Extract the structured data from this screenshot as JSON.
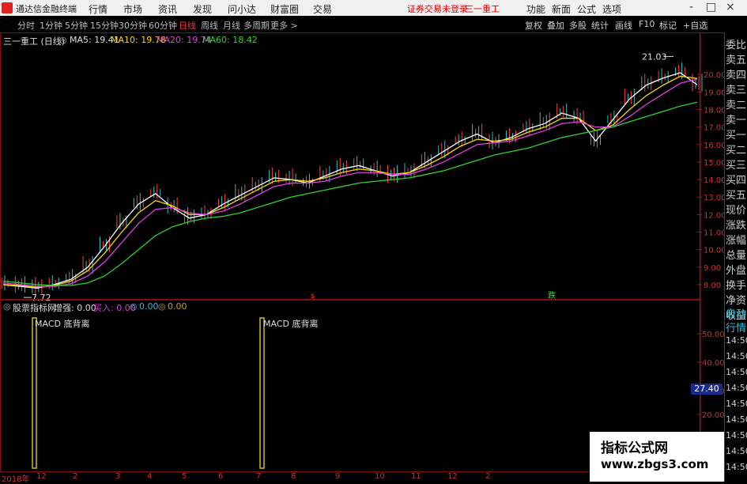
{
  "app": {
    "title": "通达信金融终端"
  },
  "menu": {
    "items": [
      "行情",
      "市场",
      "资讯",
      "发现",
      "问小达",
      "财富圈",
      "交易"
    ]
  },
  "status": {
    "not_logged_in": "证券交易未登录",
    "stock_name": "三一重工"
  },
  "top_buttons": [
    "功能",
    "新面",
    "公式",
    "选项"
  ],
  "window_controls": [
    "-",
    "□",
    "×"
  ],
  "periods": [
    "分时",
    "1分钟",
    "5分钟",
    "15分钟",
    "30分钟",
    "60分钟",
    "日线",
    "周线",
    "月线",
    "多周期",
    "更多 >"
  ],
  "active_period": "日线",
  "right_toolbar": [
    "复权",
    "叠加",
    "多股",
    "统计",
    "画线",
    "F10",
    "标记",
    "+自选"
  ],
  "main_chart": {
    "stock_label": "三一重工 (日线)",
    "ma": [
      {
        "label": "MA5: 19.41",
        "color": "#ffffff"
      },
      {
        "label": "MA10: 19.78",
        "color": "#ffd700"
      },
      {
        "label": "MA20: 19.74",
        "color": "#e040e0"
      },
      {
        "label": "MA60: 18.42",
        "color": "#30d030"
      }
    ],
    "high_label": "21.03",
    "low_label": "7.72",
    "y_ticks": [
      "20.00",
      "19.00",
      "18.00",
      "17.00",
      "16.00",
      "15.00",
      "14.00",
      "13.00",
      "12.00",
      "11.00",
      "10.00",
      "9.00",
      "8.00"
    ],
    "markers": {
      "signal_s": "s",
      "signal_die": "跌"
    }
  },
  "chart_data": {
    "type": "line",
    "title": "三一重工 (日线)",
    "ylim": [
      7.5,
      21.5
    ],
    "series": [
      {
        "name": "MA5",
        "values": [
          8.0,
          7.9,
          7.8,
          8.0,
          8.3,
          9.0,
          10.2,
          11.5,
          12.6,
          13.2,
          12.4,
          11.8,
          12.0,
          12.6,
          13.1,
          13.6,
          14.1,
          14.0,
          13.8,
          14.2,
          14.6,
          14.8,
          14.5,
          14.2,
          14.4,
          15.0,
          15.6,
          16.2,
          16.6,
          16.1,
          16.4,
          16.9,
          17.2,
          17.8,
          17.5,
          16.2,
          17.4,
          18.6,
          19.4,
          19.8,
          20.1,
          19.41
        ]
      },
      {
        "name": "MA10",
        "values": [
          8.0,
          7.95,
          7.85,
          7.95,
          8.2,
          8.8,
          9.8,
          11.0,
          12.1,
          12.8,
          12.5,
          12.0,
          12.0,
          12.4,
          12.9,
          13.4,
          13.9,
          14.0,
          13.9,
          14.1,
          14.4,
          14.6,
          14.5,
          14.3,
          14.4,
          14.8,
          15.3,
          15.9,
          16.3,
          16.2,
          16.3,
          16.7,
          17.0,
          17.5,
          17.5,
          16.8,
          17.1,
          18.0,
          18.8,
          19.4,
          19.9,
          19.78
        ]
      },
      {
        "name": "MA20",
        "values": [
          8.1,
          8.0,
          7.9,
          7.9,
          8.05,
          8.5,
          9.3,
          10.4,
          11.5,
          12.3,
          12.4,
          12.1,
          12.0,
          12.2,
          12.6,
          13.1,
          13.6,
          13.8,
          13.8,
          13.9,
          14.2,
          14.4,
          14.4,
          14.3,
          14.3,
          14.6,
          15.0,
          15.5,
          16.0,
          16.1,
          16.2,
          16.5,
          16.8,
          17.2,
          17.3,
          17.0,
          17.0,
          17.6,
          18.3,
          18.9,
          19.5,
          19.74
        ]
      },
      {
        "name": "MA60",
        "values": [
          8.2,
          8.1,
          8.0,
          7.95,
          7.95,
          8.1,
          8.5,
          9.2,
          10.0,
          10.8,
          11.3,
          11.6,
          11.8,
          11.9,
          12.1,
          12.4,
          12.7,
          13.0,
          13.2,
          13.4,
          13.6,
          13.8,
          13.9,
          14.0,
          14.1,
          14.3,
          14.5,
          14.8,
          15.1,
          15.4,
          15.6,
          15.8,
          16.1,
          16.4,
          16.6,
          16.8,
          17.0,
          17.3,
          17.6,
          17.9,
          18.2,
          18.42
        ]
      }
    ]
  },
  "lower_panel": {
    "label": "股票指标网",
    "zeng_label": "增强: 0.00",
    "buy_label": "买入: 0.00",
    "value2": "0.00",
    "value3": "0.00",
    "signal_text": "MACD 底背离",
    "y_ticks": [
      "50.00",
      "40.00",
      "30.00",
      "20.00"
    ],
    "current_value": "27.40"
  },
  "side_panel": {
    "items": [
      "委比",
      "卖五",
      "卖四",
      "卖三",
      "卖二",
      "卖一",
      "买一",
      "买二",
      "买三",
      "买四",
      "买五",
      "现价",
      "涨跌",
      "涨幅",
      "总量",
      "外盘",
      "换手",
      "净资",
      "收益"
    ],
    "bottom_items": [
      "自动",
      "行情"
    ],
    "times": [
      "14:50",
      "14:50",
      "14:50",
      "14:50",
      "14:50",
      "14:50",
      "14:50",
      "14:50",
      "14:50"
    ]
  },
  "date_axis": {
    "year_label": "2018年",
    "ticks": [
      "12",
      "2",
      "3",
      "4",
      "5",
      "6",
      "7",
      "8",
      "9",
      "10",
      "11",
      "12",
      "2"
    ]
  },
  "watermark": {
    "line1": "指标公式网",
    "line2": "www.zbgs3.com"
  }
}
